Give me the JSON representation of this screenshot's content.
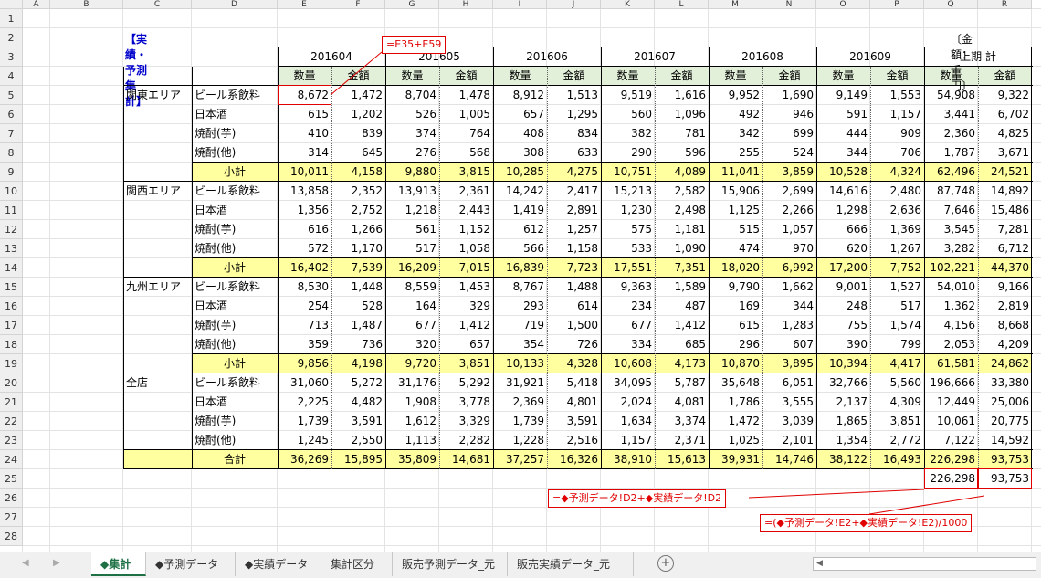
{
  "columns": [
    "A",
    "B",
    "C",
    "D",
    "E",
    "F",
    "G",
    "H",
    "I",
    "J",
    "K",
    "L",
    "M",
    "N",
    "O",
    "P",
    "Q",
    "R"
  ],
  "rows": [
    "1",
    "2",
    "3",
    "4",
    "5",
    "6",
    "7",
    "8",
    "9",
    "10",
    "11",
    "12",
    "13",
    "14",
    "15",
    "16",
    "17",
    "18",
    "19",
    "20",
    "21",
    "22",
    "23",
    "24",
    "25",
    "26",
    "27",
    "28"
  ],
  "title": "【実績・予測集計】",
  "unit_note": "〔金額：千円〕",
  "periods": [
    "201604",
    "201605",
    "201606",
    "201607",
    "201608",
    "201609",
    "上期 計"
  ],
  "measure_labels": {
    "qty": "数量",
    "amt": "金額"
  },
  "regions": [
    {
      "name": "関東エリア",
      "rows": [
        {
          "product": "ビール系飲料",
          "values": [
            "8,672",
            "1,472",
            "8,704",
            "1,478",
            "8,912",
            "1,513",
            "9,519",
            "1,616",
            "9,952",
            "1,690",
            "9,149",
            "1,553",
            "54,908",
            "9,322"
          ]
        },
        {
          "product": "日本酒",
          "values": [
            "615",
            "1,202",
            "526",
            "1,005",
            "657",
            "1,295",
            "560",
            "1,096",
            "492",
            "946",
            "591",
            "1,157",
            "3,441",
            "6,702"
          ]
        },
        {
          "product": "焼酎(芋)",
          "values": [
            "410",
            "839",
            "374",
            "764",
            "408",
            "834",
            "382",
            "781",
            "342",
            "699",
            "444",
            "909",
            "2,360",
            "4,825"
          ]
        },
        {
          "product": "焼酎(他)",
          "values": [
            "314",
            "645",
            "276",
            "568",
            "308",
            "633",
            "290",
            "596",
            "255",
            "524",
            "344",
            "706",
            "1,787",
            "3,671"
          ]
        }
      ],
      "subtotal_label": "小計",
      "subtotal": [
        "10,011",
        "4,158",
        "9,880",
        "3,815",
        "10,285",
        "4,275",
        "10,751",
        "4,089",
        "11,041",
        "3,859",
        "10,528",
        "4,324",
        "62,496",
        "24,521"
      ]
    },
    {
      "name": "関西エリア",
      "rows": [
        {
          "product": "ビール系飲料",
          "values": [
            "13,858",
            "2,352",
            "13,913",
            "2,361",
            "14,242",
            "2,417",
            "15,213",
            "2,582",
            "15,906",
            "2,699",
            "14,616",
            "2,480",
            "87,748",
            "14,892"
          ]
        },
        {
          "product": "日本酒",
          "values": [
            "1,356",
            "2,752",
            "1,218",
            "2,443",
            "1,419",
            "2,891",
            "1,230",
            "2,498",
            "1,125",
            "2,266",
            "1,298",
            "2,636",
            "7,646",
            "15,486"
          ]
        },
        {
          "product": "焼酎(芋)",
          "values": [
            "616",
            "1,266",
            "561",
            "1,152",
            "612",
            "1,257",
            "575",
            "1,181",
            "515",
            "1,057",
            "666",
            "1,369",
            "3,545",
            "7,281"
          ]
        },
        {
          "product": "焼酎(他)",
          "values": [
            "572",
            "1,170",
            "517",
            "1,058",
            "566",
            "1,158",
            "533",
            "1,090",
            "474",
            "970",
            "620",
            "1,267",
            "3,282",
            "6,712"
          ]
        }
      ],
      "subtotal_label": "小計",
      "subtotal": [
        "16,402",
        "7,539",
        "16,209",
        "7,015",
        "16,839",
        "7,723",
        "17,551",
        "7,351",
        "18,020",
        "6,992",
        "17,200",
        "7,752",
        "102,221",
        "44,370"
      ]
    },
    {
      "name": "九州エリア",
      "rows": [
        {
          "product": "ビール系飲料",
          "values": [
            "8,530",
            "1,448",
            "8,559",
            "1,453",
            "8,767",
            "1,488",
            "9,363",
            "1,589",
            "9,790",
            "1,662",
            "9,001",
            "1,527",
            "54,010",
            "9,166"
          ]
        },
        {
          "product": "日本酒",
          "values": [
            "254",
            "528",
            "164",
            "329",
            "293",
            "614",
            "234",
            "487",
            "169",
            "344",
            "248",
            "517",
            "1,362",
            "2,819"
          ]
        },
        {
          "product": "焼酎(芋)",
          "values": [
            "713",
            "1,487",
            "677",
            "1,412",
            "719",
            "1,500",
            "677",
            "1,412",
            "615",
            "1,283",
            "755",
            "1,574",
            "4,156",
            "8,668"
          ]
        },
        {
          "product": "焼酎(他)",
          "values": [
            "359",
            "736",
            "320",
            "657",
            "354",
            "726",
            "334",
            "685",
            "296",
            "607",
            "390",
            "799",
            "2,053",
            "4,209"
          ]
        }
      ],
      "subtotal_label": "小計",
      "subtotal": [
        "9,856",
        "4,198",
        "9,720",
        "3,851",
        "10,133",
        "4,328",
        "10,608",
        "4,173",
        "10,870",
        "3,895",
        "10,394",
        "4,417",
        "61,581",
        "24,862"
      ]
    },
    {
      "name": "全店",
      "rows": [
        {
          "product": "ビール系飲料",
          "values": [
            "31,060",
            "5,272",
            "31,176",
            "5,292",
            "31,921",
            "5,418",
            "34,095",
            "5,787",
            "35,648",
            "6,051",
            "32,766",
            "5,560",
            "196,666",
            "33,380"
          ]
        },
        {
          "product": "日本酒",
          "values": [
            "2,225",
            "4,482",
            "1,908",
            "3,778",
            "2,369",
            "4,801",
            "2,024",
            "4,081",
            "1,786",
            "3,555",
            "2,137",
            "4,309",
            "12,449",
            "25,006"
          ]
        },
        {
          "product": "焼酎(芋)",
          "values": [
            "1,739",
            "3,591",
            "1,612",
            "3,329",
            "1,739",
            "3,591",
            "1,634",
            "3,374",
            "1,472",
            "3,039",
            "1,865",
            "3,851",
            "10,061",
            "20,775"
          ]
        },
        {
          "product": "焼酎(他)",
          "values": [
            "1,245",
            "2,550",
            "1,113",
            "2,282",
            "1,228",
            "2,516",
            "1,157",
            "2,371",
            "1,025",
            "2,101",
            "1,354",
            "2,772",
            "7,122",
            "14,592"
          ]
        }
      ],
      "subtotal_label": "合計",
      "subtotal": [
        "36,269",
        "15,895",
        "35,809",
        "14,681",
        "37,257",
        "16,326",
        "38,910",
        "15,613",
        "39,931",
        "14,746",
        "38,122",
        "16,493",
        "226,298",
        "93,753"
      ]
    }
  ],
  "check_row": {
    "q": "226,298",
    "r": "93,753"
  },
  "callouts": {
    "e5": "=E35+E59",
    "q25": "=◆予測データ!D2+◆実績データ!D2",
    "r25": "=(◆予測データ!E2+◆実績データ!E2)/1000"
  },
  "tabs": [
    "◆集計",
    "◆予測データ",
    "◆実績データ",
    "集計区分",
    "販売予測データ_元",
    "販売実績データ_元"
  ],
  "active_tab": 0,
  "colors": {
    "title": "#0000cc",
    "callout": "#e00000",
    "header_fill": "#e2efd9",
    "subtotal_fill": "#ffff9f",
    "active_tab": "#1e7145"
  }
}
